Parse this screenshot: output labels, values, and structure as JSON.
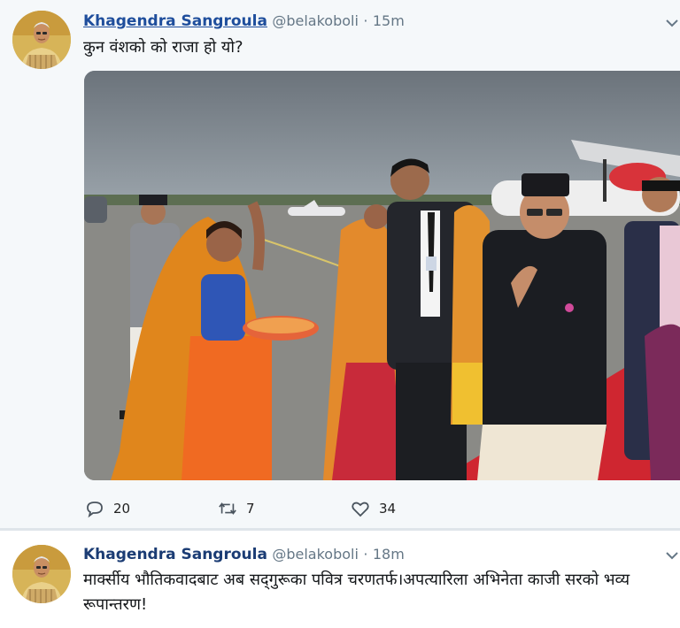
{
  "tweets": [
    {
      "author_name": "Khagendra Sangroula",
      "author_handle": "@belakoboli",
      "separator": "·",
      "time": "15m",
      "text": "कुन वंशको को राजा हो यो?",
      "actions": {
        "reply_count": "20",
        "retweet_count": "7",
        "like_count": "34"
      }
    },
    {
      "author_name": "Khagendra Sangroula",
      "author_handle": "@belakoboli",
      "separator": "·",
      "time": "18m",
      "text": "मार्क्सीय भौतिकवादबाट अब सद्‌गुरूका पवित्र चरणतर्फ।अपत्यारिला अभिनेता काजी सरको भव्य रूपान्तरण!"
    }
  ],
  "icons": {
    "reply": "reply-icon",
    "retweet": "retweet-icon",
    "like": "heart-icon",
    "more": "chevron-down-icon"
  },
  "colors": {
    "name_link": "#1f4e9c",
    "muted": "#657786",
    "background": "#f5f8fa",
    "carpet": "#d8232a",
    "saffron": "#e8901e"
  }
}
